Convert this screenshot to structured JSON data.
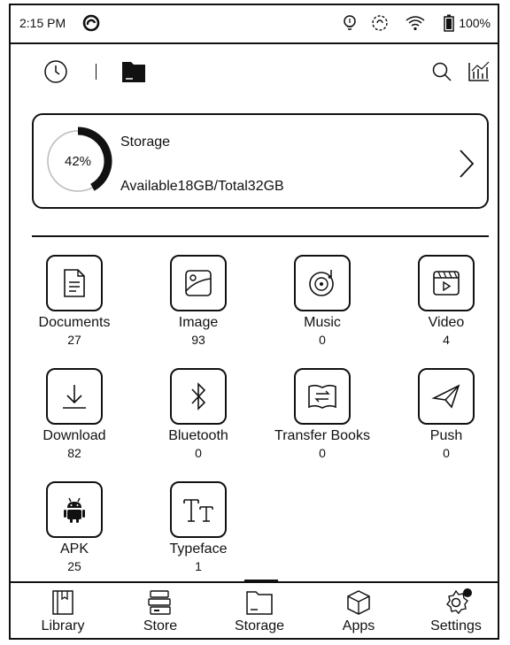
{
  "status_bar": {
    "time": "2:15 PM",
    "battery_percent": "100%",
    "icons": [
      "sync-app-icon",
      "bulb-icon",
      "refresh-icon",
      "wifi-icon",
      "battery-icon"
    ]
  },
  "toolbar": {
    "icons": [
      "clock-icon",
      "folder-icon",
      "search-icon",
      "stats-icon"
    ]
  },
  "storage": {
    "title": "Storage",
    "percent_label": "42%",
    "used_fraction": 0.42,
    "detail": "Available18GB/Total32GB"
  },
  "categories": [
    {
      "label": "Documents",
      "count": "27",
      "icon": "document-icon"
    },
    {
      "label": "Image",
      "count": "93",
      "icon": "image-icon"
    },
    {
      "label": "Music",
      "count": "0",
      "icon": "music-icon"
    },
    {
      "label": "Video",
      "count": "4",
      "icon": "video-icon"
    },
    {
      "label": "Download",
      "count": "82",
      "icon": "download-icon"
    },
    {
      "label": "Bluetooth",
      "count": "0",
      "icon": "bluetooth-icon"
    },
    {
      "label": "Transfer Books",
      "count": "0",
      "icon": "transfer-books-icon"
    },
    {
      "label": "Push",
      "count": "0",
      "icon": "push-icon"
    },
    {
      "label": "APK",
      "count": "25",
      "icon": "android-icon"
    },
    {
      "label": "Typeface",
      "count": "1",
      "icon": "typeface-icon"
    }
  ],
  "bottom_nav": [
    {
      "label": "Library",
      "icon": "library-icon"
    },
    {
      "label": "Store",
      "icon": "store-icon"
    },
    {
      "label": "Storage",
      "icon": "storage-icon",
      "active": true
    },
    {
      "label": "Apps",
      "icon": "apps-icon"
    },
    {
      "label": "Settings",
      "icon": "settings-icon",
      "badge": true
    }
  ]
}
